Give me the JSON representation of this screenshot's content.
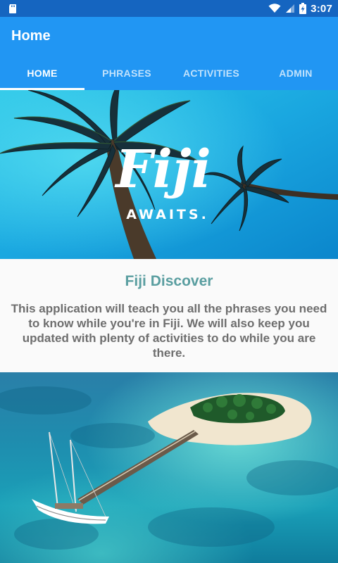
{
  "status_bar": {
    "time": "3:07",
    "icons": [
      "sd-card-icon",
      "wifi-icon",
      "signal-icon",
      "battery-charging-icon"
    ]
  },
  "app_bar": {
    "title": "Home"
  },
  "tabs": [
    {
      "label": "HOME",
      "active": true
    },
    {
      "label": "PHRASES",
      "active": false
    },
    {
      "label": "ACTIVITIES",
      "active": false
    },
    {
      "label": "ADMIN",
      "active": false
    }
  ],
  "hero": {
    "logo_script": "Fiji",
    "logo_tagline": "AWAITS."
  },
  "intro": {
    "heading": "Fiji Discover",
    "body": "This application will teach you all the phrases you need to know while you're in Fiji. We will also keep you updated with plenty of activities to do while you are there."
  },
  "colors": {
    "status_bar": "#1565c0",
    "app_bar": "#2196f3",
    "heading": "#5a9ea0",
    "body_text": "#6e6e6e"
  }
}
